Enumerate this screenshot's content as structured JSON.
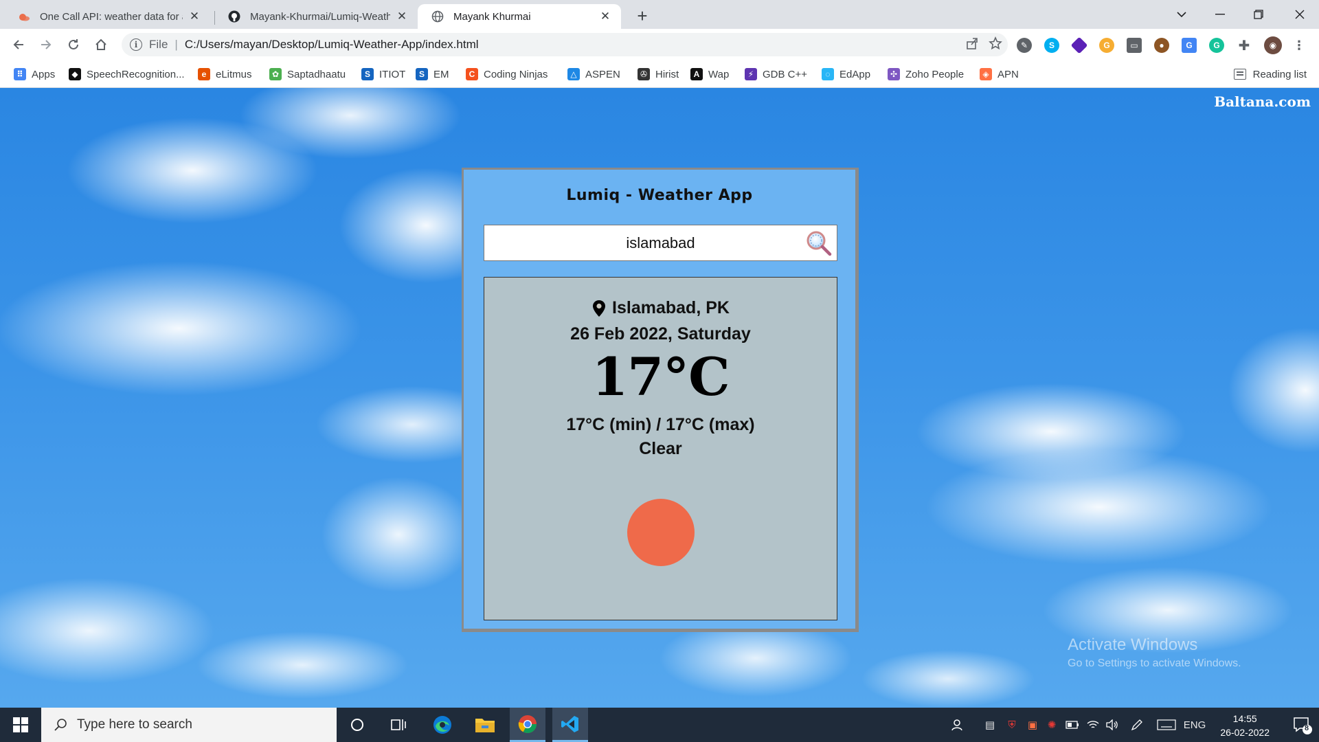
{
  "browser": {
    "tabs": [
      {
        "title": "One Call API: weather data for any"
      },
      {
        "title": "Mayank-Khurmai/Lumiq-Weather-App"
      },
      {
        "title": "Mayank Khurmai"
      }
    ],
    "address": {
      "scheme_label": "File",
      "url": "C:/Users/mayan/Desktop/Lumiq-Weather-App/index.html"
    },
    "bookmarks": [
      {
        "label": "Apps",
        "icon": "apps-grid-icon",
        "color": "#4285f4"
      },
      {
        "label": "SpeechRecognition...",
        "icon": "speech-icon",
        "color": "#111111"
      },
      {
        "label": "eLitmus",
        "icon": "elitmus-icon",
        "color": "#e65100"
      },
      {
        "label": "Saptadhaatu",
        "icon": "saptadhaatu-icon",
        "color": "#4caf50"
      },
      {
        "label": "ITIOT",
        "icon": "itiot-icon",
        "color": "#1565c0"
      },
      {
        "label": "EM",
        "icon": "em-icon",
        "color": "#1565c0"
      },
      {
        "label": "Coding Ninjas",
        "icon": "coding-ninjas-icon",
        "color": "#f4511e"
      },
      {
        "label": "ASPEN",
        "icon": "aspen-icon",
        "color": "#1e88e5"
      },
      {
        "label": "Hirist",
        "icon": "hirist-icon",
        "color": "#333333"
      },
      {
        "label": "Wap",
        "icon": "wap-icon",
        "color": "#111111"
      },
      {
        "label": "GDB C++",
        "icon": "gdb-icon",
        "color": "#5e35b1"
      },
      {
        "label": "EdApp",
        "icon": "edapp-icon",
        "color": "#29b6f6"
      },
      {
        "label": "Zoho People",
        "icon": "zoho-icon",
        "color": "#7e57c2"
      },
      {
        "label": "APN",
        "icon": "apn-icon",
        "color": "#ff7043"
      }
    ],
    "reading_list": "Reading list"
  },
  "page": {
    "watermark": "Baltana.com",
    "app_title": "Lumiq - Weather App",
    "search": {
      "value": "islamabad",
      "placeholder": ""
    },
    "weather": {
      "location": "Islamabad, PK",
      "date": "26 Feb 2022, Saturday",
      "temperature": "17°C",
      "min_max": "17°C (min) / 17°C (max)",
      "condition": "Clear",
      "icon": "sun-icon",
      "icon_color": "#ef6a4a"
    },
    "activate": {
      "title": "Activate Windows",
      "subtitle": "Go to Settings to activate Windows."
    }
  },
  "taskbar": {
    "search_placeholder": "Type here to search",
    "language": "ENG",
    "time": "14:55",
    "date": "26-02-2022",
    "notifications": "8"
  }
}
